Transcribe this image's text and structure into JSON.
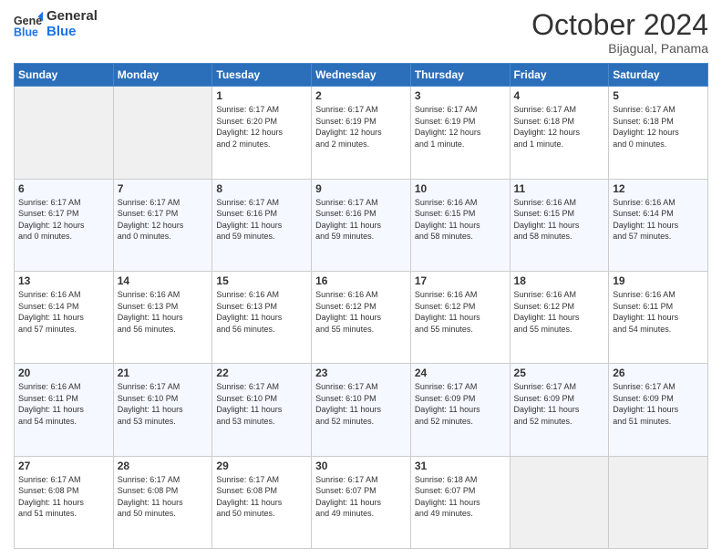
{
  "header": {
    "logo_line1": "General",
    "logo_line2": "Blue",
    "month": "October 2024",
    "location": "Bijagual, Panama"
  },
  "weekdays": [
    "Sunday",
    "Monday",
    "Tuesday",
    "Wednesday",
    "Thursday",
    "Friday",
    "Saturday"
  ],
  "weeks": [
    [
      {
        "day": "",
        "info": ""
      },
      {
        "day": "",
        "info": ""
      },
      {
        "day": "1",
        "info": "Sunrise: 6:17 AM\nSunset: 6:20 PM\nDaylight: 12 hours\nand 2 minutes."
      },
      {
        "day": "2",
        "info": "Sunrise: 6:17 AM\nSunset: 6:19 PM\nDaylight: 12 hours\nand 2 minutes."
      },
      {
        "day": "3",
        "info": "Sunrise: 6:17 AM\nSunset: 6:19 PM\nDaylight: 12 hours\nand 1 minute."
      },
      {
        "day": "4",
        "info": "Sunrise: 6:17 AM\nSunset: 6:18 PM\nDaylight: 12 hours\nand 1 minute."
      },
      {
        "day": "5",
        "info": "Sunrise: 6:17 AM\nSunset: 6:18 PM\nDaylight: 12 hours\nand 0 minutes."
      }
    ],
    [
      {
        "day": "6",
        "info": "Sunrise: 6:17 AM\nSunset: 6:17 PM\nDaylight: 12 hours\nand 0 minutes."
      },
      {
        "day": "7",
        "info": "Sunrise: 6:17 AM\nSunset: 6:17 PM\nDaylight: 12 hours\nand 0 minutes."
      },
      {
        "day": "8",
        "info": "Sunrise: 6:17 AM\nSunset: 6:16 PM\nDaylight: 11 hours\nand 59 minutes."
      },
      {
        "day": "9",
        "info": "Sunrise: 6:17 AM\nSunset: 6:16 PM\nDaylight: 11 hours\nand 59 minutes."
      },
      {
        "day": "10",
        "info": "Sunrise: 6:16 AM\nSunset: 6:15 PM\nDaylight: 11 hours\nand 58 minutes."
      },
      {
        "day": "11",
        "info": "Sunrise: 6:16 AM\nSunset: 6:15 PM\nDaylight: 11 hours\nand 58 minutes."
      },
      {
        "day": "12",
        "info": "Sunrise: 6:16 AM\nSunset: 6:14 PM\nDaylight: 11 hours\nand 57 minutes."
      }
    ],
    [
      {
        "day": "13",
        "info": "Sunrise: 6:16 AM\nSunset: 6:14 PM\nDaylight: 11 hours\nand 57 minutes."
      },
      {
        "day": "14",
        "info": "Sunrise: 6:16 AM\nSunset: 6:13 PM\nDaylight: 11 hours\nand 56 minutes."
      },
      {
        "day": "15",
        "info": "Sunrise: 6:16 AM\nSunset: 6:13 PM\nDaylight: 11 hours\nand 56 minutes."
      },
      {
        "day": "16",
        "info": "Sunrise: 6:16 AM\nSunset: 6:12 PM\nDaylight: 11 hours\nand 55 minutes."
      },
      {
        "day": "17",
        "info": "Sunrise: 6:16 AM\nSunset: 6:12 PM\nDaylight: 11 hours\nand 55 minutes."
      },
      {
        "day": "18",
        "info": "Sunrise: 6:16 AM\nSunset: 6:12 PM\nDaylight: 11 hours\nand 55 minutes."
      },
      {
        "day": "19",
        "info": "Sunrise: 6:16 AM\nSunset: 6:11 PM\nDaylight: 11 hours\nand 54 minutes."
      }
    ],
    [
      {
        "day": "20",
        "info": "Sunrise: 6:16 AM\nSunset: 6:11 PM\nDaylight: 11 hours\nand 54 minutes."
      },
      {
        "day": "21",
        "info": "Sunrise: 6:17 AM\nSunset: 6:10 PM\nDaylight: 11 hours\nand 53 minutes."
      },
      {
        "day": "22",
        "info": "Sunrise: 6:17 AM\nSunset: 6:10 PM\nDaylight: 11 hours\nand 53 minutes."
      },
      {
        "day": "23",
        "info": "Sunrise: 6:17 AM\nSunset: 6:10 PM\nDaylight: 11 hours\nand 52 minutes."
      },
      {
        "day": "24",
        "info": "Sunrise: 6:17 AM\nSunset: 6:09 PM\nDaylight: 11 hours\nand 52 minutes."
      },
      {
        "day": "25",
        "info": "Sunrise: 6:17 AM\nSunset: 6:09 PM\nDaylight: 11 hours\nand 52 minutes."
      },
      {
        "day": "26",
        "info": "Sunrise: 6:17 AM\nSunset: 6:09 PM\nDaylight: 11 hours\nand 51 minutes."
      }
    ],
    [
      {
        "day": "27",
        "info": "Sunrise: 6:17 AM\nSunset: 6:08 PM\nDaylight: 11 hours\nand 51 minutes."
      },
      {
        "day": "28",
        "info": "Sunrise: 6:17 AM\nSunset: 6:08 PM\nDaylight: 11 hours\nand 50 minutes."
      },
      {
        "day": "29",
        "info": "Sunrise: 6:17 AM\nSunset: 6:08 PM\nDaylight: 11 hours\nand 50 minutes."
      },
      {
        "day": "30",
        "info": "Sunrise: 6:17 AM\nSunset: 6:07 PM\nDaylight: 11 hours\nand 49 minutes."
      },
      {
        "day": "31",
        "info": "Sunrise: 6:18 AM\nSunset: 6:07 PM\nDaylight: 11 hours\nand 49 minutes."
      },
      {
        "day": "",
        "info": ""
      },
      {
        "day": "",
        "info": ""
      }
    ]
  ]
}
